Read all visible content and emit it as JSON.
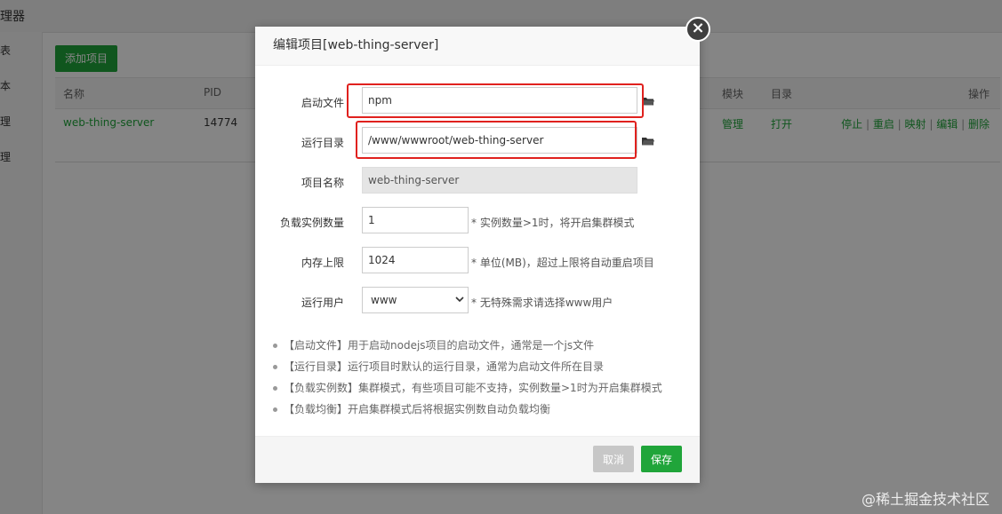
{
  "app": {
    "title": "理器",
    "nav": [
      "表",
      "本",
      "理",
      "理"
    ],
    "add_button": "添加项目",
    "table": {
      "headers": {
        "name": "名称",
        "pid": "PID",
        "module": "模块",
        "dir": "目录",
        "ops": "操作"
      },
      "row": {
        "name": "web-thing-server",
        "pid": "14774",
        "module": "管理",
        "dir": "打开"
      },
      "ops": [
        "停止",
        "重启",
        "映射",
        "编辑",
        "删除"
      ],
      "separator": "|"
    }
  },
  "modal": {
    "title": "编辑项目[web-thing-server]",
    "close_icon": "×",
    "fields": {
      "start_file": {
        "label": "启动文件",
        "value": "npm"
      },
      "run_dir": {
        "label": "运行目录",
        "value": "/www/wwwroot/web-thing-server"
      },
      "project_name": {
        "label": "项目名称",
        "value": "web-thing-server"
      },
      "instances": {
        "label": "负载实例数量",
        "value": "1",
        "hint": "* 实例数量>1时，将开启集群模式"
      },
      "mem_limit": {
        "label": "内存上限",
        "value": "1024",
        "hint": "* 单位(MB)，超过上限将自动重启项目"
      },
      "run_user": {
        "label": "运行用户",
        "value": "www",
        "hint": "* 无特殊需求请选择www用户"
      }
    },
    "tips": [
      "【启动文件】用于启动nodejs项目的启动文件，通常是一个js文件",
      "【运行目录】运行项目时默认的运行目录，通常为启动文件所在目录",
      "【负载实例数】集群模式，有些项目可能不支持，实例数量>1时为开启集群模式",
      "【负载均衡】开启集群模式后将根据实例数自动负载均衡"
    ],
    "cancel": "取消",
    "save": "保存"
  },
  "colors": {
    "accent": "#20a53a",
    "highlight": "#e0211e"
  },
  "watermark": "@稀土掘金技术社区"
}
